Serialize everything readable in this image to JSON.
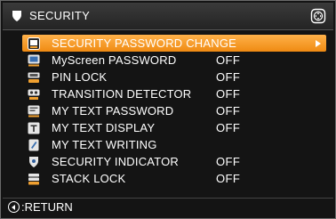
{
  "window": {
    "title": "SECURITY",
    "title_icon": "shield-icon",
    "nav_icon": "dpad-icon"
  },
  "menu": {
    "items": [
      {
        "label": "SECURITY PASSWORD CHANGE",
        "value": "",
        "icon": "password-change-icon",
        "selected": true,
        "has_submenu": true
      },
      {
        "label": "MyScreen PASSWORD",
        "value": "OFF",
        "icon": "myscreen-password-icon"
      },
      {
        "label": "PIN LOCK",
        "value": "OFF",
        "icon": "pin-lock-icon"
      },
      {
        "label": "TRANSITION DETECTOR",
        "value": "OFF",
        "icon": "transition-detector-icon"
      },
      {
        "label": "MY TEXT PASSWORD",
        "value": "OFF",
        "icon": "my-text-password-icon"
      },
      {
        "label": "MY TEXT DISPLAY",
        "value": "OFF",
        "icon": "my-text-display-icon"
      },
      {
        "label": "MY TEXT WRITING",
        "value": "",
        "icon": "my-text-writing-icon"
      },
      {
        "label": "SECURITY INDICATOR",
        "value": "OFF",
        "icon": "security-indicator-icon"
      },
      {
        "label": "STACK LOCK",
        "value": "OFF",
        "icon": "stack-lock-icon"
      }
    ]
  },
  "footer": {
    "return_label": ":RETURN",
    "return_icon": "left-key-icon"
  },
  "colors": {
    "background": "#141414",
    "highlight": "#f39a22",
    "text": "#ffffff"
  }
}
